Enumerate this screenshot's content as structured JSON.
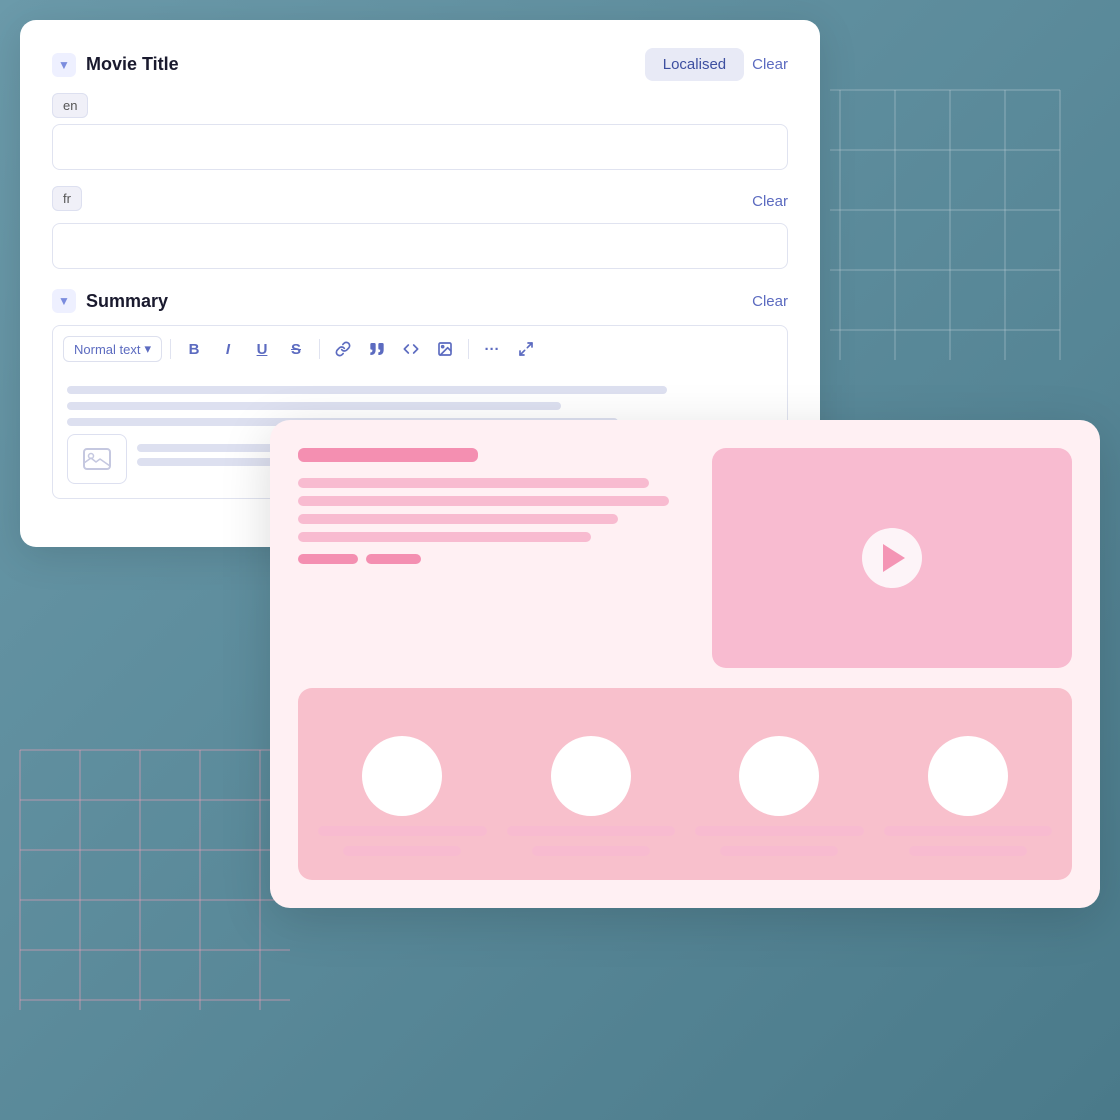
{
  "bg": {
    "color": "#5a8a9f"
  },
  "formCard": {
    "movieTitle": {
      "title": "Movie Title",
      "localised_label": "Localised",
      "clear_label": "Clear",
      "collapse_icon": "▼",
      "en_badge": "en",
      "fr_badge": "fr",
      "fr_clear_label": "Clear",
      "en_placeholder": "",
      "fr_placeholder": ""
    },
    "summary": {
      "title": "Summary",
      "clear_label": "Clear",
      "toolbar": {
        "normal_text": "Normal text",
        "chevron": "▾",
        "bold": "B",
        "italic": "I",
        "underline": "U",
        "strike": "S",
        "link": "🔗",
        "quote": "❝",
        "code": "</>",
        "image": "🖼",
        "more": "···",
        "fullscreen": "⛶"
      }
    }
  },
  "previewCard": {
    "play_icon": "▶"
  },
  "thumbnails": [
    {
      "id": 1
    },
    {
      "id": 2
    },
    {
      "id": 3
    },
    {
      "id": 4
    }
  ]
}
